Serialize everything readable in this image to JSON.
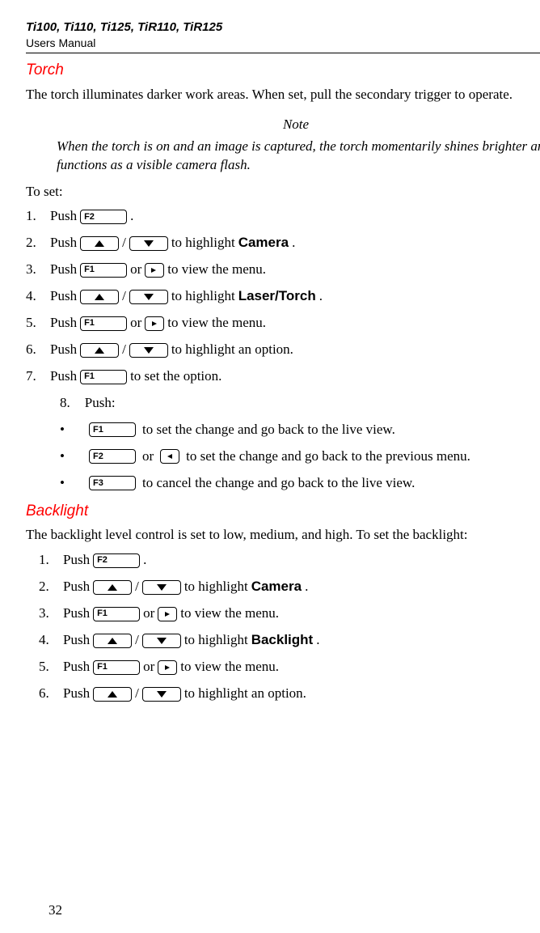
{
  "header": {
    "title": "Ti100, Ti110, Ti125, TiR110, TiR125",
    "subtitle": "Users Manual"
  },
  "keys": {
    "f1": "F1",
    "f2": "F2",
    "f3": "F3"
  },
  "torch": {
    "title": "Torch",
    "intro": "The torch illuminates darker work areas. When set, pull the secondary trigger to operate.",
    "note_label": "Note",
    "note_body": "When the torch is on and an image is captured, the torch momentarily shines brighter and functions as a visible camera flash.",
    "to_set": "To set:",
    "steps": [
      {
        "n": "1.",
        "pre": "Push ",
        "post": "."
      },
      {
        "n": "2.",
        "pre": "Push ",
        "mid": "/",
        "tail": " to highlight ",
        "bold": "Camera",
        "end": "."
      },
      {
        "n": "3.",
        "pre": "Push ",
        "or": " or ",
        "tail": " to view the menu."
      },
      {
        "n": "4.",
        "pre": "Push ",
        "mid": "/",
        "tail": " to highlight ",
        "bold": "Laser/Torch",
        "end": "."
      },
      {
        "n": "5.",
        "pre": "Push ",
        "or": " or ",
        "tail": " to view the menu."
      },
      {
        "n": "6.",
        "pre": "Push ",
        "mid": "/",
        "tail": " to highlight an option."
      },
      {
        "n": "7.",
        "pre": "Push ",
        "tail": " to set the option."
      }
    ],
    "step8": {
      "n": "8.",
      "label": "Push:"
    },
    "bullets": [
      {
        "tail": " to set the change and go back to the live view."
      },
      {
        "or": " or ",
        "tail": " to set the change and go back to the previous menu."
      },
      {
        "tail": " to cancel the change and go back to the live view."
      }
    ]
  },
  "backlight": {
    "title": "Backlight",
    "intro": "The backlight level control is set to low, medium, and high. To set the backlight:",
    "steps": [
      {
        "n": "1.",
        "pre": "Push ",
        "post": "."
      },
      {
        "n": "2.",
        "pre": "Push ",
        "mid": "/",
        "tail": " to highlight ",
        "bold": "Camera",
        "end": "."
      },
      {
        "n": "3.",
        "pre": "Push ",
        "or": " or ",
        "tail": " to view the menu."
      },
      {
        "n": "4.",
        "pre": "Push ",
        "mid": "/",
        "tail": " to highlight ",
        "bold": "Backlight",
        "end": "."
      },
      {
        "n": "5.",
        "pre": "Push ",
        "or": " or ",
        "tail": " to view the menu."
      },
      {
        "n": "6.",
        "pre": "Push ",
        "mid": "/",
        "tail": " to highlight an option."
      }
    ]
  },
  "page_number": "32"
}
